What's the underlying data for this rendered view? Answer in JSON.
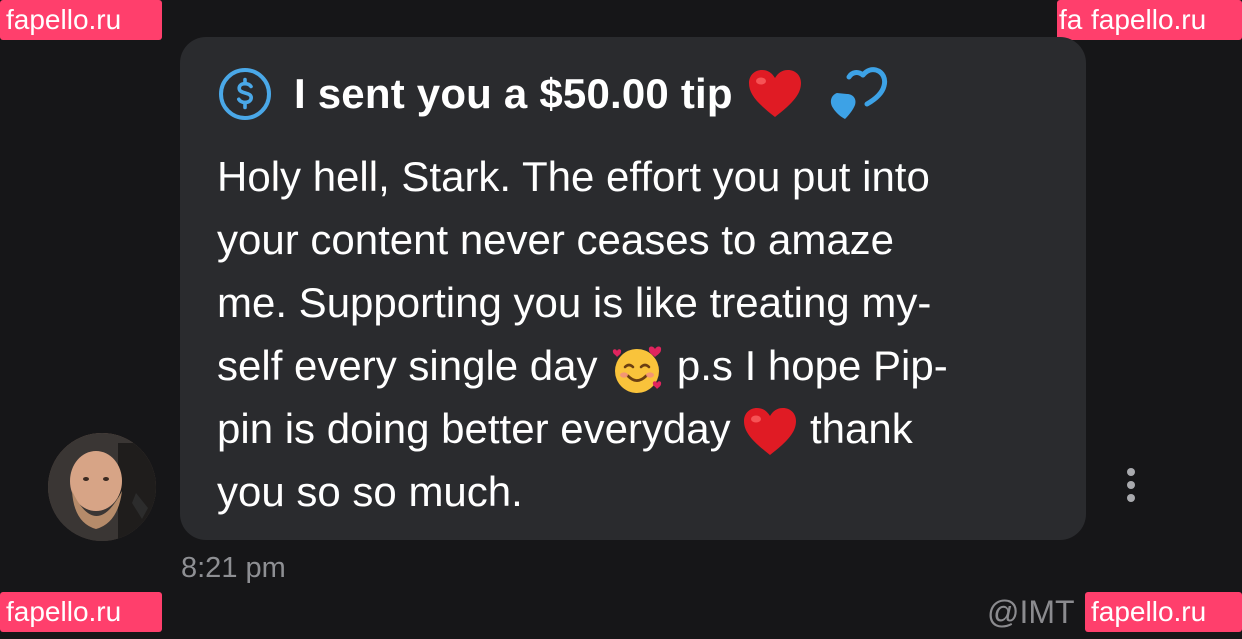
{
  "watermarks": {
    "top_left": "fapello.ru",
    "top_right": "fapello.ru",
    "top_right_fragment": "fa",
    "bottom_left": "fapello.ru",
    "bottom_right": "fapello.ru"
  },
  "message": {
    "tip_text": "I sent you a $50.00 tip",
    "body_line1": "Holy hell, Stark. The effort you put into",
    "body_line2": "your content never ceases to amaze",
    "body_line3": "me. Supporting you is like treating my-",
    "body_line4a": "self every single day",
    "body_line4b": " p.s I hope Pip-",
    "body_line5a": "pin is doing better everyday",
    "body_line5b": " thank",
    "body_line6": "you so so much.",
    "timestamp": "8:21 pm"
  },
  "footer": {
    "handle": "@IMT"
  },
  "icons": {
    "dollar": "dollar-circle-icon",
    "heart_red": "red-heart-icon",
    "heart_blue": "blue-heart-icon",
    "smile_hearts": "smiling-face-with-hearts-icon",
    "more": "more-vertical-icon"
  },
  "colors": {
    "background": "#161618",
    "bubble": "#2a2b2e",
    "accent_blue": "#4aa8e8",
    "watermark": "#ff3f6c",
    "timestamp": "#8e8f93"
  }
}
